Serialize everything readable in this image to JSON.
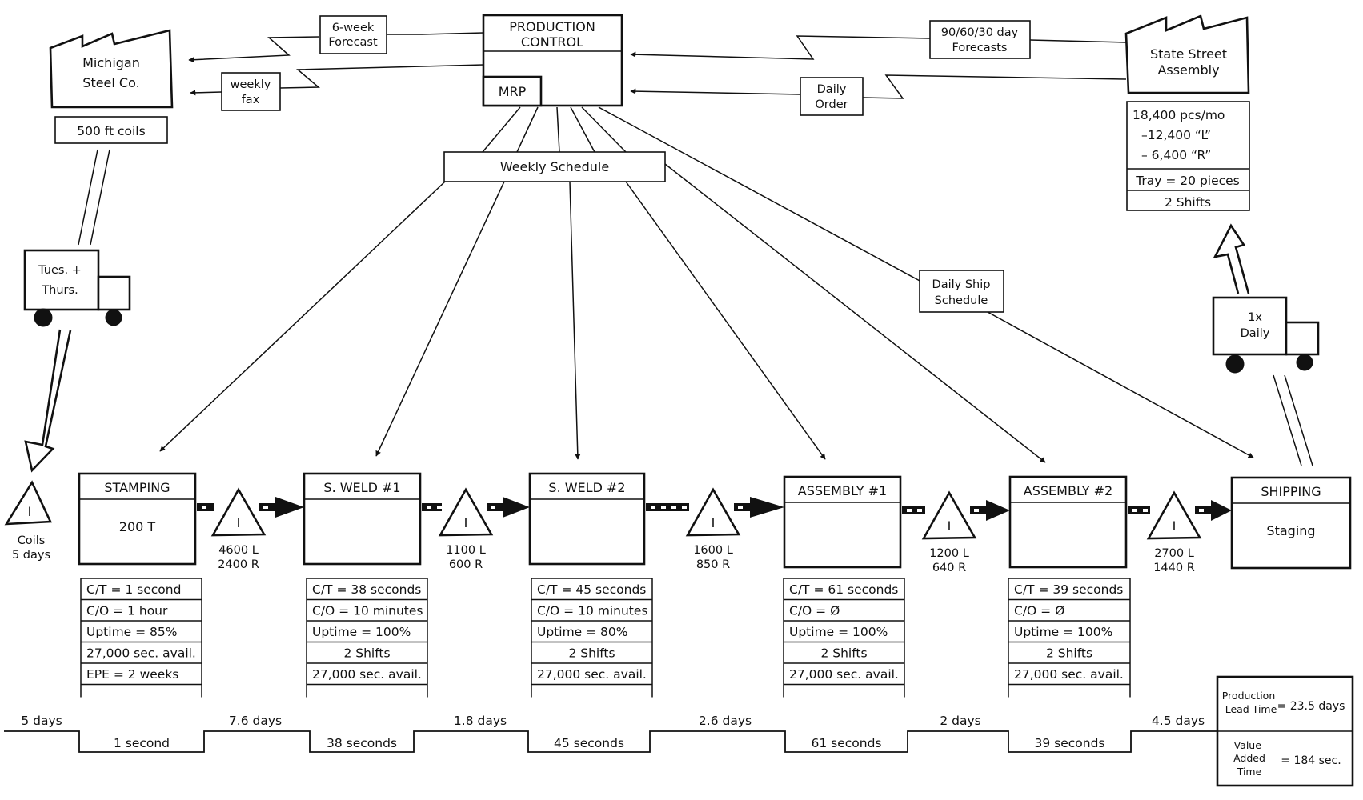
{
  "supplier": {
    "name_line1": "Michigan",
    "name_line2": "Steel Co.",
    "note": "500 ft coils"
  },
  "customer": {
    "name_line1": "State Street",
    "name_line2": "Assembly",
    "demand_line1": "18,400 pcs/mo",
    "demand_line2": "–12,400  “L”",
    "demand_line3": "– 6,400  “R”",
    "tray": "Tray = 20 pieces",
    "shifts": "2 Shifts"
  },
  "production_control": {
    "title_line1": "PRODUCTION",
    "title_line2": "CONTROL",
    "system": "MRP"
  },
  "info_flows": {
    "six_week_line1": "6-week",
    "six_week_line2": "Forecast",
    "weekly_fax_line1": "weekly",
    "weekly_fax_line2": "fax",
    "forecasts_line1": "90/60/30 day",
    "forecasts_line2": "Forecasts",
    "daily_order_line1": "Daily",
    "daily_order_line2": "Order",
    "weekly_schedule": "Weekly Schedule",
    "daily_ship_line1": "Daily Ship",
    "daily_ship_line2": "Schedule"
  },
  "trucks": {
    "inbound_line1": "Tues. +",
    "inbound_line2": "Thurs.",
    "outbound_line1": "1x",
    "outbound_line2": "Daily"
  },
  "raw_inventory": {
    "symbol": "I",
    "line1": "Coils",
    "line2": "5 days"
  },
  "processes": [
    {
      "name": "STAMPING",
      "body": "200 T",
      "data": [
        "C/T = 1 second",
        "C/O =  1 hour",
        "Uptime = 85%",
        "27,000 sec. avail.",
        "EPE = 2 weeks"
      ]
    },
    {
      "name": "S. WELD #1",
      "body": "",
      "data": [
        "C/T = 38 seconds",
        "C/O =  10 minutes",
        "Uptime = 100%",
        "2 Shifts",
        "27,000 sec. avail."
      ]
    },
    {
      "name": "S. WELD #2",
      "body": "",
      "data": [
        "C/T = 45 seconds",
        "C/O =  10 minutes",
        "Uptime = 80%",
        "2 Shifts",
        "27,000 sec. avail."
      ]
    },
    {
      "name": "ASSEMBLY #1",
      "body": "",
      "data": [
        "C/T = 61 seconds",
        "C/O =  Ø",
        "Uptime = 100%",
        "2 Shifts",
        "27,000 sec. avail."
      ]
    },
    {
      "name": "ASSEMBLY #2",
      "body": "",
      "data": [
        "C/T = 39 seconds",
        "C/O =  Ø",
        "Uptime = 100%",
        "2 Shifts",
        "27,000 sec. avail."
      ]
    },
    {
      "name": "SHIPPING",
      "body": "Staging",
      "data": []
    }
  ],
  "inventories": [
    {
      "symbol": "I",
      "line1": "4600 L",
      "line2": "2400 R"
    },
    {
      "symbol": "I",
      "line1": "1100 L",
      "line2": "600 R"
    },
    {
      "symbol": "I",
      "line1": "1600 L",
      "line2": "850 R"
    },
    {
      "symbol": "I",
      "line1": "1200 L",
      "line2": "640 R"
    },
    {
      "symbol": "I",
      "line1": "2700 L",
      "line2": "1440 R"
    }
  ],
  "timeline": {
    "wait_times": [
      "5 days",
      "7.6 days",
      "1.8 days",
      "2.6 days",
      "2 days",
      "4.5 days"
    ],
    "process_times": [
      "1 second",
      "38 seconds",
      "45 seconds",
      "61 seconds",
      "39 seconds"
    ]
  },
  "summary": {
    "lead_label_line1": "Production",
    "lead_label_line2": "Lead Time",
    "lead_value": "= 23.5 days",
    "va_label_line1": "Value-",
    "va_label_line2": "Added",
    "va_label_line3": "Time",
    "va_value": "= 184 sec."
  }
}
